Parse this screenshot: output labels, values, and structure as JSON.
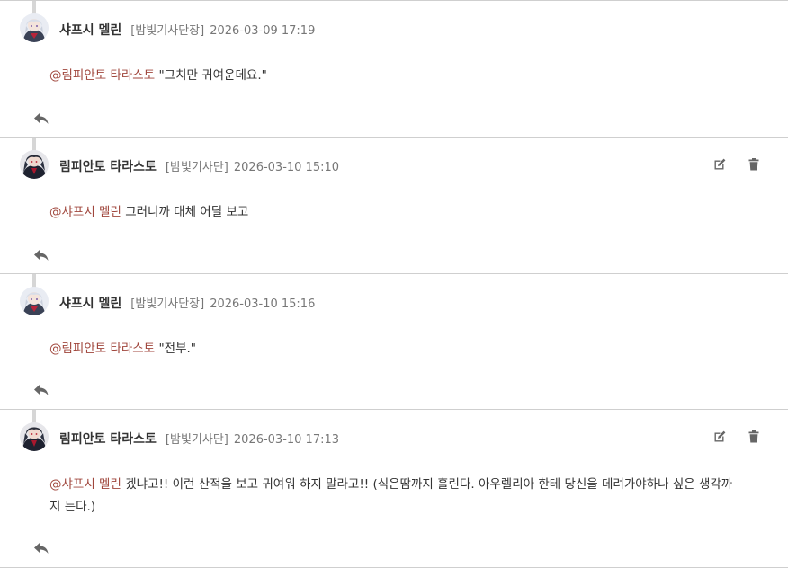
{
  "colors": {
    "mention": "#a0463c",
    "meta": "#777777",
    "divider": "#cfcfcf",
    "icon": "#666666"
  },
  "comments": [
    {
      "author": "샤프시 멜린",
      "role": "[밤빛기사단장]",
      "time": "2026-03-09 17:19",
      "mention": "@림피안토 타라스토",
      "text": "\"그치만 귀여운데요.\"",
      "avatar_icon": "avatar-light-haired",
      "can_edit": false
    },
    {
      "author": "림피안토 타라스토",
      "role": "[밤빛기사단]",
      "time": "2026-03-10 15:10",
      "mention": "@샤프시 멜린",
      "text": "그러니까 대체 어딜 보고",
      "avatar_icon": "avatar-dark-haired",
      "can_edit": true
    },
    {
      "author": "샤프시 멜린",
      "role": "[밤빛기사단장]",
      "time": "2026-03-10 15:16",
      "mention": "@림피안토 타라스토",
      "text": "\"전부.\"",
      "avatar_icon": "avatar-light-haired",
      "can_edit": false
    },
    {
      "author": "림피안토 타라스토",
      "role": "[밤빛기사단]",
      "time": "2026-03-10 17:13",
      "mention": "@샤프시 멜린",
      "text": "겠냐고!! 이런 산적을 보고 귀여워 하지 말라고!! (식은땀까지 흘린다. 아우렐리아 한테 당신을 데려가야하나 싶은 생각까지 든다.)",
      "avatar_icon": "avatar-dark-haired",
      "can_edit": true
    }
  ]
}
